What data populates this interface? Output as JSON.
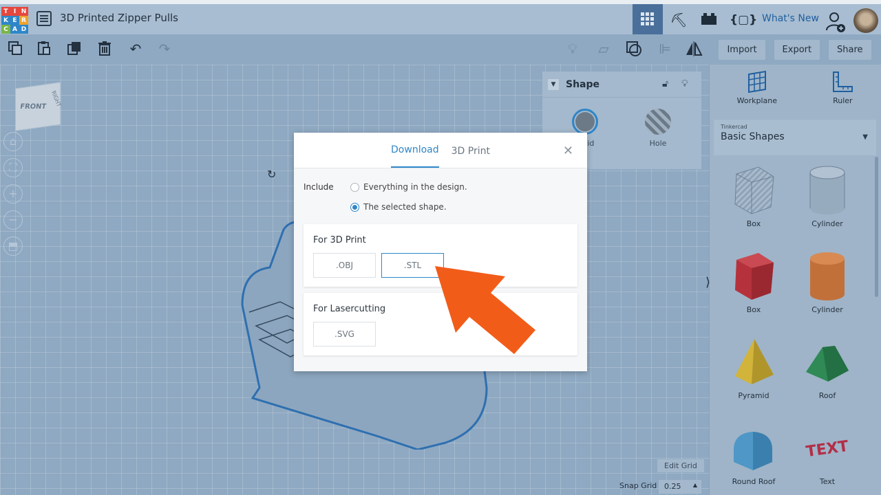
{
  "app": {
    "logo_letters": [
      "T",
      "I",
      "N",
      "K",
      "E",
      "R",
      "C",
      "A",
      "D"
    ],
    "logo_colors": [
      "#e5473f",
      "#e5473f",
      "#e5473f",
      "#2e86c9",
      "#2e86c9",
      "#f0a32b",
      "#7ab648",
      "#2e86c9",
      "#2e86c9"
    ],
    "document_title": "3D Printed Zipper Pulls",
    "whats_new": "What's New"
  },
  "actions": {
    "import": "Import",
    "export": "Export",
    "share": "Share"
  },
  "shape_panel": {
    "title": "Shape",
    "solid_label": "Solid",
    "hole_label": "Hole"
  },
  "library": {
    "workplane": "Workplane",
    "ruler": "Ruler",
    "source": "Tinkercad",
    "category": "Basic Shapes",
    "items": [
      {
        "label": "Box",
        "icon": "box-striped-icon"
      },
      {
        "label": "Cylinder",
        "icon": "cylinder-striped-icon"
      },
      {
        "label": "Box",
        "icon": "box-red-icon"
      },
      {
        "label": "Cylinder",
        "icon": "cylinder-orange-icon"
      },
      {
        "label": "Pyramid",
        "icon": "pyramid-icon"
      },
      {
        "label": "Roof",
        "icon": "roof-icon"
      },
      {
        "label": "Round Roof",
        "icon": "round-roof-icon"
      },
      {
        "label": "Text",
        "icon": "text-icon"
      }
    ]
  },
  "viewcube": {
    "front": "FRONT",
    "right": "RIGHT"
  },
  "grid": {
    "edit_grid": "Edit Grid",
    "snap_label": "Snap Grid",
    "snap_value": "0.25"
  },
  "modal": {
    "tabs": [
      "Download",
      "3D Print"
    ],
    "active_tab": "Download",
    "include_label": "Include",
    "option_all": "Everything in the design.",
    "option_selected": "The selected shape.",
    "selected_option": "The selected shape.",
    "print_section": "For 3D Print",
    "print_formats": [
      ".OBJ",
      ".STL"
    ],
    "laser_section": "For Lasercutting",
    "laser_formats": [
      ".SVG"
    ]
  },
  "colors": {
    "accent": "#2e86c9",
    "callout": "#f25c19"
  }
}
